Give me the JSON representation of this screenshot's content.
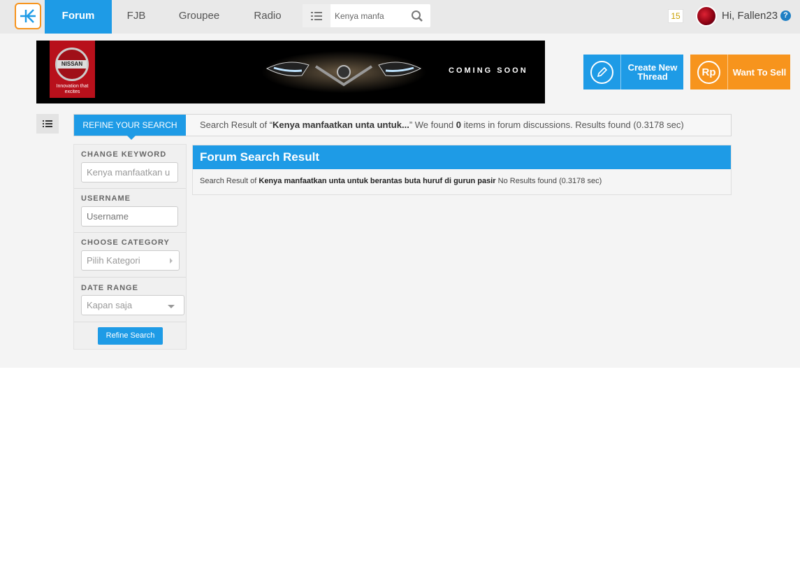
{
  "nav": {
    "items": [
      {
        "label": "Forum",
        "active": true
      },
      {
        "label": "FJB"
      },
      {
        "label": "Groupee"
      },
      {
        "label": "Radio"
      }
    ],
    "search_value": "Kenya manfa",
    "notification_count": "15",
    "greeting": "Hi, Fallen23",
    "help": "?"
  },
  "banner": {
    "brand": "NISSAN",
    "tagline": "Innovation that excites",
    "caption": "COMING SOON"
  },
  "actions": {
    "create_label": "Create New Thread",
    "sell_label": "Want To Sell",
    "sell_icon_text": "Rp"
  },
  "result_bar": {
    "refine_tab": "REFINE YOUR SEARCH",
    "prefix": "Search Result of “",
    "keyword_short": "Kenya manfaatkan unta untuk...",
    "mid": "” We found ",
    "count": "0",
    "suffix": " items in forum discussions. Results found (0.3178 sec)"
  },
  "filters": {
    "keyword_label": "CHANGE KEYWORD",
    "keyword_value": "Kenya manfaatkan u",
    "username_label": "USERNAME",
    "username_placeholder": "Username",
    "category_label": "CHOOSE CATEGORY",
    "category_value": "Pilih Kategori",
    "date_label": "DATE RANGE",
    "date_value": "Kapan saja",
    "submit_label": "Refine Search"
  },
  "result_panel": {
    "title": "Forum Search Result",
    "prefix": "Search Result of ",
    "keyword": "Kenya manfaatkan unta untuk berantas buta huruf di gurun pasir",
    "suffix": " No Results found (0.3178 sec)"
  },
  "colors": {
    "primary": "#1e9be6",
    "orange": "#f7941d"
  }
}
